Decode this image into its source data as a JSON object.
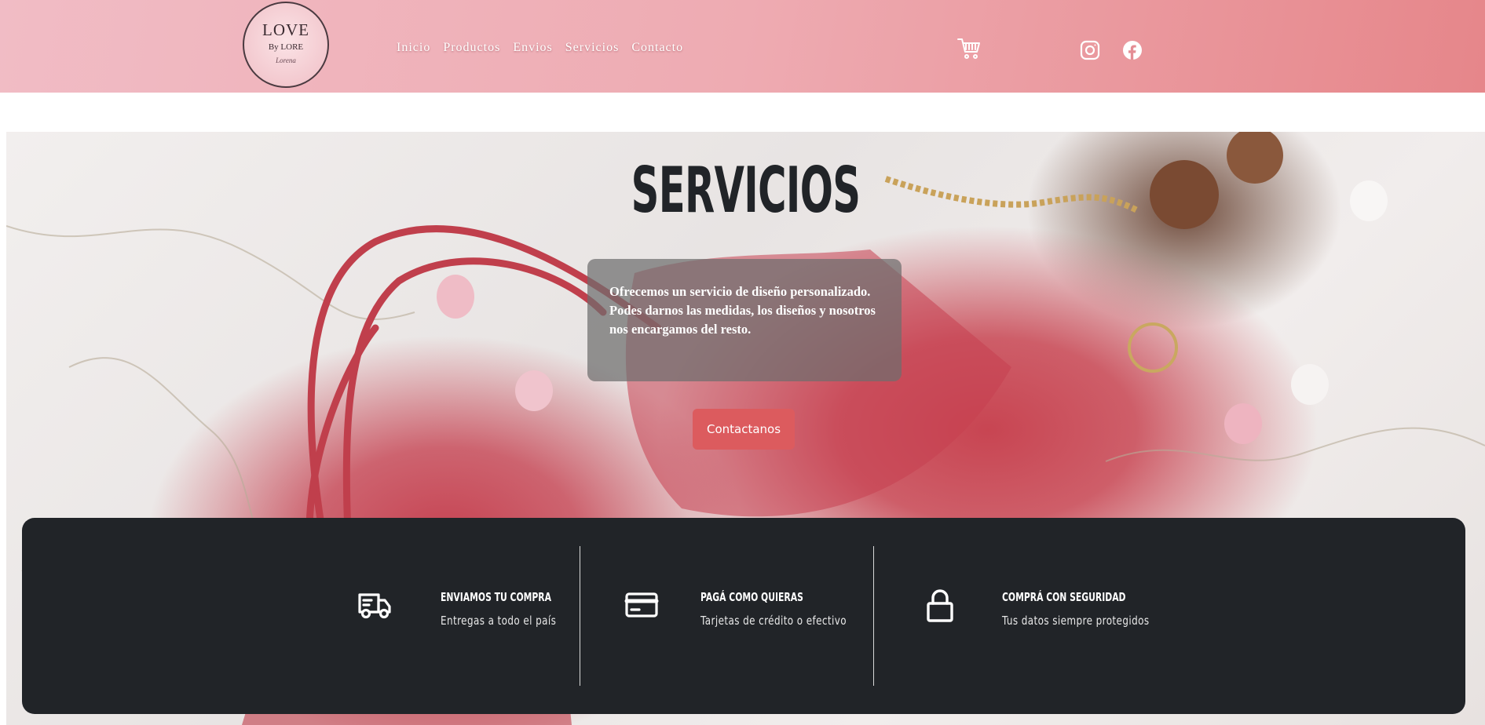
{
  "header": {
    "logo": {
      "main": "LOVE",
      "sub": "By LORE",
      "signature": "Lorena"
    },
    "nav": [
      {
        "label": "Inicio"
      },
      {
        "label": "Productos"
      },
      {
        "label": "Envios"
      },
      {
        "label": "Servicios"
      },
      {
        "label": "Contacto"
      }
    ],
    "icons": [
      "cart-icon",
      "instagram-icon",
      "facebook-icon"
    ]
  },
  "hero": {
    "title": "SERVICIOS",
    "description": "Ofrecemos un servicio de diseño personalizado. Podes darnos las medidas, los diseños y nosotros nos encargamos del resto.",
    "button_label": "Contactanos"
  },
  "features": [
    {
      "icon": "truck-icon",
      "title": "ENVIAMOS TU COMPRA",
      "subtitle": "Entregas a todo el país"
    },
    {
      "icon": "credit-card-icon",
      "title": "PAGÁ COMO QUIERAS",
      "subtitle": "Tarjetas de crédito o efectivo"
    },
    {
      "icon": "lock-icon",
      "title": "COMPRÁ CON SEGURIDAD",
      "subtitle": "Tus datos siempre protegidos"
    }
  ],
  "colors": {
    "header_gradient_start": "#f1bcc5",
    "header_gradient_end": "#e6868a",
    "button": "#dc5b5e",
    "features_bg": "#212428",
    "title": "#212428"
  }
}
